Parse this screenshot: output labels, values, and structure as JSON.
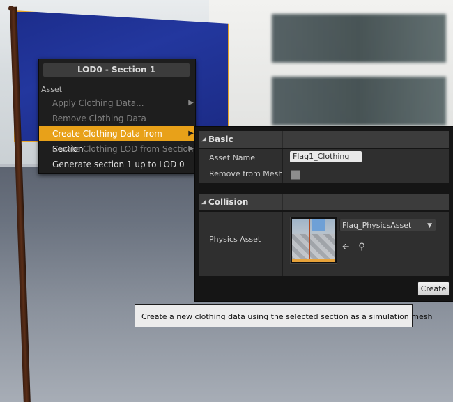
{
  "context_menu": {
    "header": "LOD0 - Section 1",
    "section_label": "Asset",
    "items": [
      {
        "label": "Apply Clothing Data...",
        "state": "disabled",
        "has_submenu": true
      },
      {
        "label": "Remove Clothing Data",
        "state": "disabled",
        "has_submenu": false
      },
      {
        "label": "Create Clothing Data from Section",
        "state": "highlighted",
        "has_submenu": true
      },
      {
        "label": "Create Clothing LOD from Section",
        "state": "disabled",
        "has_submenu": true
      },
      {
        "label": "Generate section 1 up to LOD 0",
        "state": "enabled",
        "has_submenu": false
      }
    ]
  },
  "options_panel": {
    "basic": {
      "title": "Basic",
      "asset_name_label": "Asset Name",
      "asset_name_value": "Flag1_Clothing",
      "remove_from_mesh_label": "Remove from Mesh",
      "remove_from_mesh_checked": false
    },
    "collision": {
      "title": "Collision",
      "physics_asset_label": "Physics Asset",
      "physics_asset_value": "Flag_PhysicsAsset"
    },
    "create_button": "Create"
  },
  "tooltip": "Create a new clothing data using the selected section as a simulation mesh",
  "colors": {
    "highlight": "#e8a119",
    "menu_bg": "#1e1e1e",
    "panel_bg": "#151515",
    "flag_blue": "#1f3195"
  },
  "icons": {
    "collapse": "triangle-down-icon",
    "submenu": "triangle-right-icon",
    "use_selected": "left-arrow-icon",
    "browse": "magnifier-icon",
    "dropdown": "chevron-down-icon"
  }
}
